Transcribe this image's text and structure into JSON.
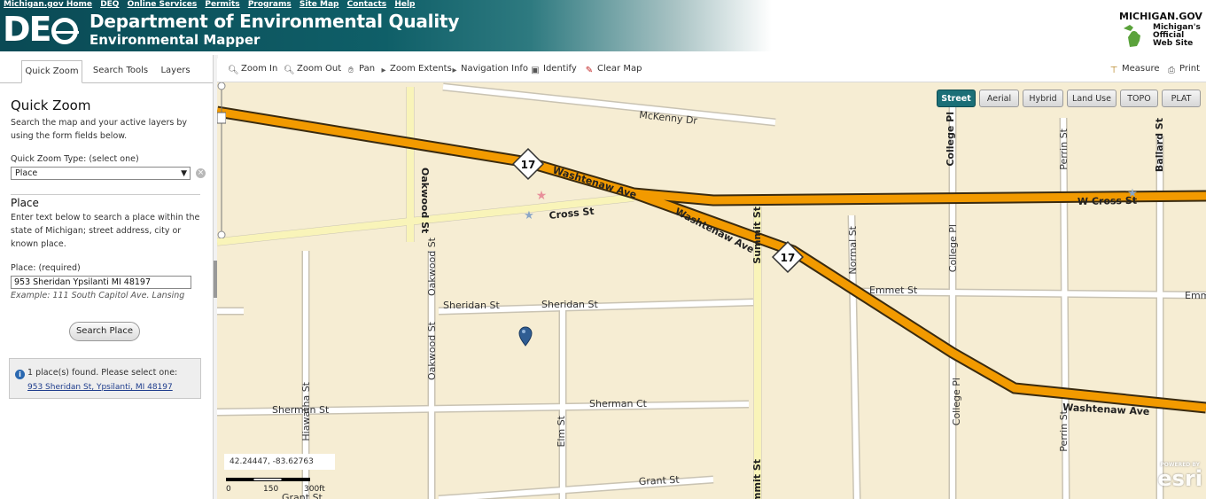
{
  "header": {
    "top_links": [
      "Michigan.gov Home",
      "DEQ",
      "Online Services",
      "Permits",
      "Programs",
      "Site Map",
      "Contacts",
      "Help"
    ],
    "logo_text": "DEQ",
    "title": "Department of Environmental Quality",
    "subtitle": "Environmental Mapper",
    "state_logo": {
      "site": "MICHIGAN.GOV",
      "tagline": [
        "Michigan's",
        "Official",
        "Web Site"
      ]
    }
  },
  "tabs": [
    "Quick Zoom",
    "Search Tools",
    "Layers"
  ],
  "quick_zoom": {
    "title": "Quick Zoom",
    "description": "Search the map and your active layers by using the form fields below.",
    "type_label": "Quick Zoom Type: (select one)",
    "type_value": "Place",
    "place_title": "Place",
    "place_description": "Enter text below to search a place within the state of Michigan; street address, city or known place.",
    "place_label": "Place: (required)",
    "place_value": "953 Sheridan Ypsilanti MI 48197",
    "place_example": "Example: 111 South Capitol Ave. Lansing",
    "search_button": "Search Place",
    "result_message": "1 place(s) found. Please select one:",
    "result_link": "953 Sheridan St, Ypsilanti, MI 48197"
  },
  "toolbar": {
    "zoom_in": "Zoom In",
    "zoom_out": "Zoom Out",
    "pan": "Pan",
    "zoom_extents": "Zoom Extents",
    "navigation_info": "Navigation Info",
    "identify": "Identify",
    "clear_map": "Clear Map",
    "measure": "Measure",
    "print": "Print"
  },
  "basemaps": [
    "Street",
    "Aerial",
    "Hybrid",
    "Land Use",
    "TOPO",
    "PLAT"
  ],
  "active_basemap": "Street",
  "map": {
    "coordinates": "42.24447, -83.62763",
    "scale_labels": [
      "0",
      "150",
      "300ft"
    ],
    "attribution": "esri",
    "attribution_small": "POWERED BY",
    "route_shield": "17",
    "streets": {
      "mckenny": "McKenny Dr",
      "washtenaw": "Washtenaw Ave",
      "w_cross": "W Cross St",
      "cross": "Cross St",
      "oakwood": "Oakwood St",
      "summit": "Summit St",
      "normal": "Normal St",
      "college_pl": "College Pl",
      "college": "College Pl",
      "perrin": "Perrin St",
      "ballard": "Ballard St",
      "emmet": "Emmet St",
      "sheridan": "Sheridan St",
      "hiawatha": "Hiawatha St",
      "sherman": "Sherman St",
      "sherman_ct": "Sherman Ct",
      "elm": "Elm St",
      "grant": "Grant St"
    }
  },
  "colors": {
    "header_teal": "#0f5f68",
    "highway": "#f29a00",
    "map_bg": "#f6edd3",
    "active_tab": "#1b6f77"
  }
}
